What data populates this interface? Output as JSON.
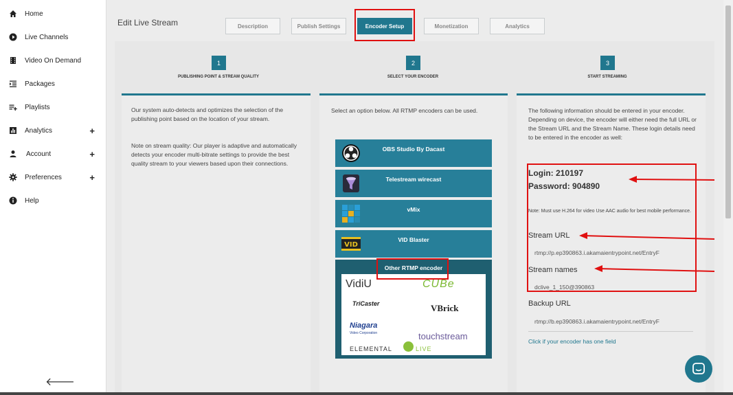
{
  "sidebar": {
    "items": [
      {
        "label": "Home",
        "icon": "home-icon",
        "expand": ""
      },
      {
        "label": "Live Channels",
        "icon": "play-circle-icon",
        "expand": ""
      },
      {
        "label": "Video On Demand",
        "icon": "film-icon",
        "expand": ""
      },
      {
        "label": "Packages",
        "icon": "list-indent-icon",
        "expand": ""
      },
      {
        "label": "Playlists",
        "icon": "playlist-add-icon",
        "expand": ""
      },
      {
        "label": "Analytics",
        "icon": "bar-chart-icon",
        "expand": "+"
      },
      {
        "label": "Account",
        "icon": "user-icon",
        "expand": "+"
      },
      {
        "label": "Preferences",
        "icon": "gear-icon",
        "expand": "+"
      },
      {
        "label": "Help",
        "icon": "info-icon",
        "expand": ""
      }
    ],
    "collapse": "🡐"
  },
  "header": {
    "title": "Edit Live Stream",
    "tabs": [
      {
        "label": "Description",
        "active": false
      },
      {
        "label": "Publish Settings",
        "active": false
      },
      {
        "label": "Encoder Setup",
        "active": true
      },
      {
        "label": "Monetization",
        "active": false
      },
      {
        "label": "Analytics",
        "active": false
      }
    ]
  },
  "steps": [
    {
      "num": "1",
      "label": "PUBLISHING POINT & STREAM QUALITY"
    },
    {
      "num": "2",
      "label": "SELECT YOUR ENCODER"
    },
    {
      "num": "3",
      "label": "START STREAMING"
    }
  ],
  "col1": {
    "p1": "Our system auto-detects and optimizes the selection of the publishing point based on the location of your stream.",
    "p2": "Note on stream quality: Our player is adaptive and automatically detects your encoder multi-bitrate settings to provide the best quality stream to your viewers based upon their connections."
  },
  "col2": {
    "intro": "Select an option below. All RTMP encoders can be used.",
    "encoders": [
      {
        "label": "OBS Studio By Dacast",
        "icon": "obs-logo-icon"
      },
      {
        "label": "Telestream wirecast",
        "icon": "wirecast-logo-icon"
      },
      {
        "label": "vMix",
        "icon": "vmix-logo-icon"
      },
      {
        "label": "VID Blaster",
        "icon": "vidblaster-logo-icon"
      }
    ],
    "other_title": "Other RTMP encoder",
    "logos": {
      "vidiu": "VidiU",
      "cube": "CUBe",
      "tricaster": "TriCaster",
      "vbrick": "VBrick",
      "niagara": "Niagara",
      "niagara_sub": "Video Corporation",
      "touchstream": "touchstream",
      "elemental": "ELEMENTAL",
      "elemental_live": "LIVE"
    }
  },
  "col3": {
    "intro": "The following information should be entered in your encoder. Depending on device, the encoder will either need the full URL or the Stream URL and the Stream Name. These login details need to be entered in the encoder as well:",
    "login": "Login: 210197",
    "password": "Password: 904890",
    "note": "Note: Must use H.264 for video Use AAC audio for best mobile performance.",
    "stream_url_label": "Stream URL",
    "stream_url": "rtmp://p.ep390863.i.akamaientrypoint.net/EntryF",
    "stream_names_label": "Stream names",
    "stream_name": "dclive_1_150@390863",
    "backup_url_label": "Backup URL",
    "backup_url": "rtmp://b.ep390863.i.akamaientrypoint.net/EntryF",
    "one_field_link": "Click if your encoder has one field"
  },
  "colors": {
    "accent": "#20778e",
    "highlight": "#e01010"
  }
}
